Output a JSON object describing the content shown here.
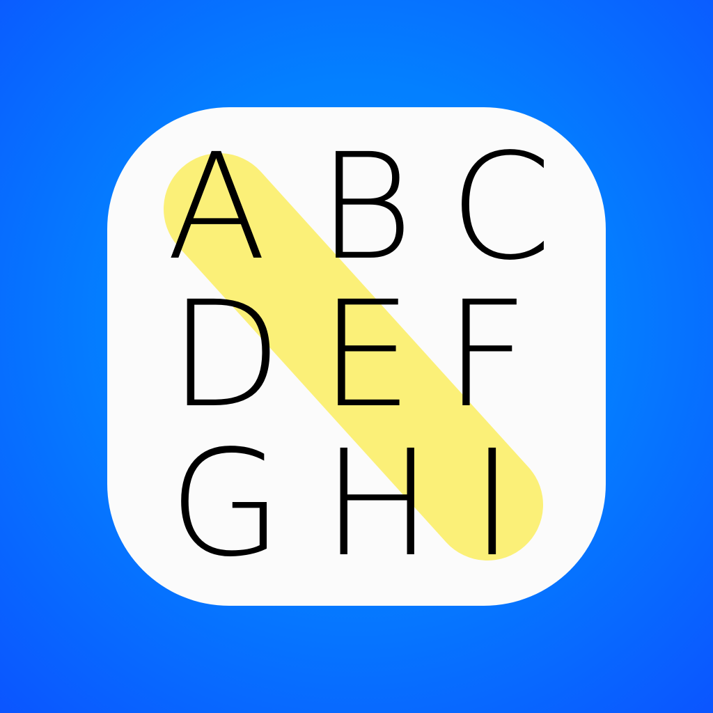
{
  "letters": [
    [
      "A",
      "B",
      "C"
    ],
    [
      "D",
      "E",
      "F"
    ],
    [
      "G",
      "H",
      "I"
    ]
  ],
  "colors": {
    "background": "#0480ff",
    "card": "#fbfbfb",
    "letter": "#000000",
    "highlight": "#fff47a"
  }
}
